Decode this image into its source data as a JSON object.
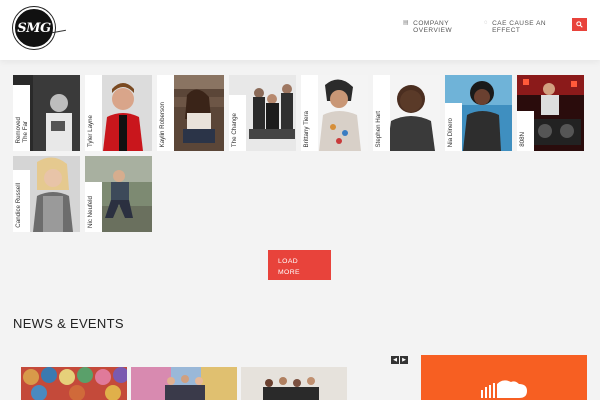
{
  "header": {
    "logo_text": "SMG",
    "nav": [
      {
        "line1": "COMPANY",
        "line2": "OVERVIEW",
        "icon": "grid-icon"
      },
      {
        "line1": "CAE CAUSE AN",
        "line2": "EFFECT",
        "icon": "circle-icon"
      }
    ],
    "search_icon": "search-icon"
  },
  "artists": [
    {
      "name": "The Far Removed",
      "line1": "The Far",
      "line2": "Removed"
    },
    {
      "name": "Tyler Layne"
    },
    {
      "name": "Kaylin Roberson"
    },
    {
      "name": "The Change"
    },
    {
      "name": "Brittany Tiera"
    },
    {
      "name": "Stephen Hart"
    },
    {
      "name": "Nia Dinero"
    },
    {
      "name": "808N"
    },
    {
      "name": "Candice Russell"
    },
    {
      "name": "Nic Neufeld"
    }
  ],
  "load_more": {
    "line1": "LOAD",
    "line2": "MORE"
  },
  "news": {
    "title": "NEWS & EVENTS",
    "prev_icon": "chevron-left-icon",
    "next_icon": "chevron-right-icon"
  },
  "colors": {
    "accent": "#e8433b",
    "soundcloud": "#f75f22"
  }
}
